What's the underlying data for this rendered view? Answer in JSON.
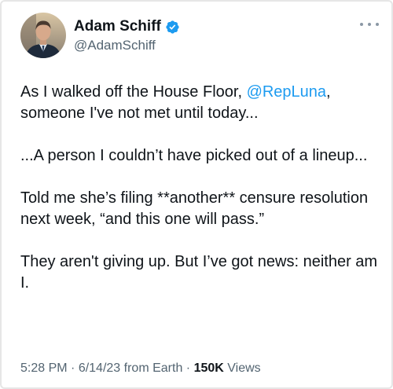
{
  "author": {
    "display_name": "Adam Schiff",
    "handle": "@AdamSchiff",
    "verified": true,
    "verified_color": "#1d9bf0",
    "avatar": "profile-photo"
  },
  "tweet": {
    "line1_before": "As I walked off the House Floor, ",
    "mention": "@RepLuna",
    "line1_after": ",",
    "line1_rest": "someone I've not met until today...",
    "para2": "...A person I couldn’t have picked out of a lineup...",
    "para3": "Told me she’s filing **another** censure resolution next week, “and this one will pass.”",
    "para4": "They aren't giving up. But I’ve got news: neither am I."
  },
  "meta": {
    "time": "5:28 PM",
    "sep1": " · ",
    "date": "6/14/23",
    "source": " from Earth",
    "sep2": " · ",
    "views_count": "150K",
    "views_label": " Views"
  },
  "colors": {
    "link": "#1d9bf0",
    "text": "#0f1419",
    "secondary": "#536471"
  }
}
